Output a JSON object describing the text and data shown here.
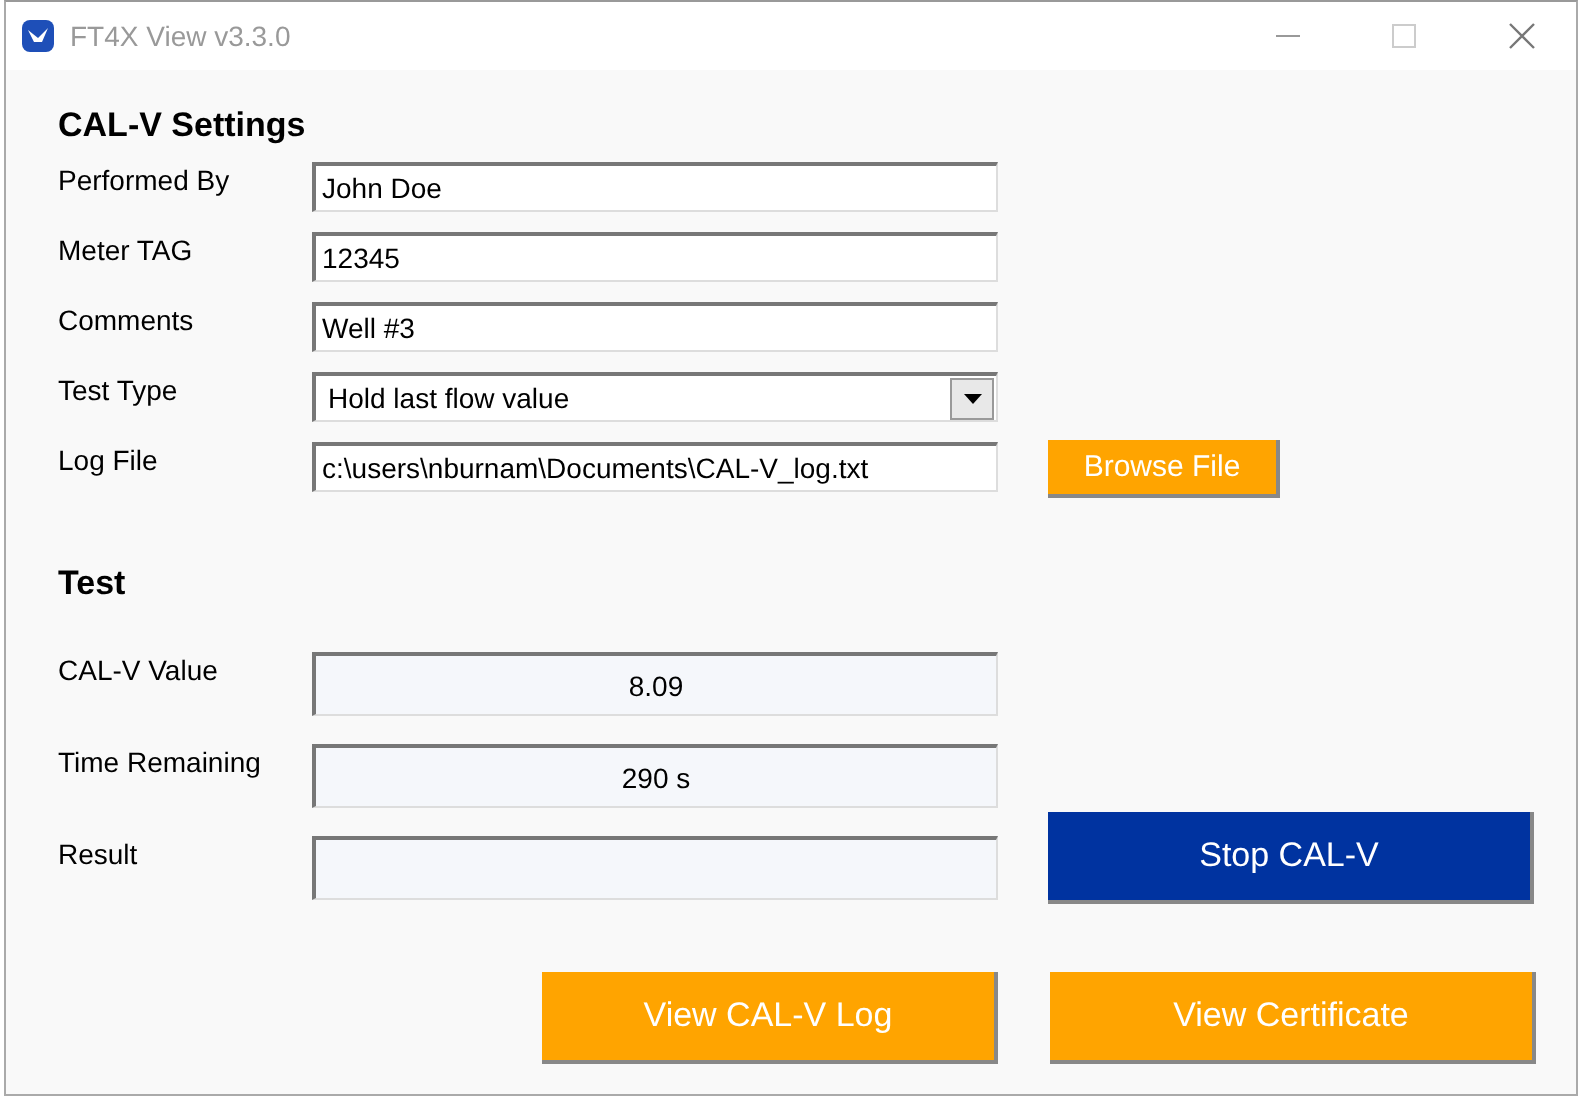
{
  "window": {
    "title": "FT4X View v3.3.0"
  },
  "settings": {
    "heading": "CAL-V Settings",
    "fields": [
      {
        "label": "Performed By",
        "kind": "text",
        "value": "John Doe"
      },
      {
        "label": "Meter TAG",
        "kind": "text",
        "value": "12345"
      },
      {
        "label": "Comments",
        "kind": "text",
        "value": "Well #3"
      },
      {
        "label": "Test Type",
        "kind": "dropdown",
        "value": "Hold last flow value"
      },
      {
        "label": "Log File",
        "kind": "text",
        "value": "c:\\users\\nburnam\\Documents\\CAL-V_log.txt",
        "button": "Browse File"
      }
    ]
  },
  "test": {
    "heading": "Test",
    "fields": [
      {
        "label": "CAL-V Value",
        "value": "8.09"
      },
      {
        "label": "Time Remaining",
        "value": "290 s"
      },
      {
        "label": "Result",
        "button": "Stop CAL-V"
      }
    ]
  },
  "buttons": [
    "View CAL-V Log",
    "View Certificate"
  ]
}
